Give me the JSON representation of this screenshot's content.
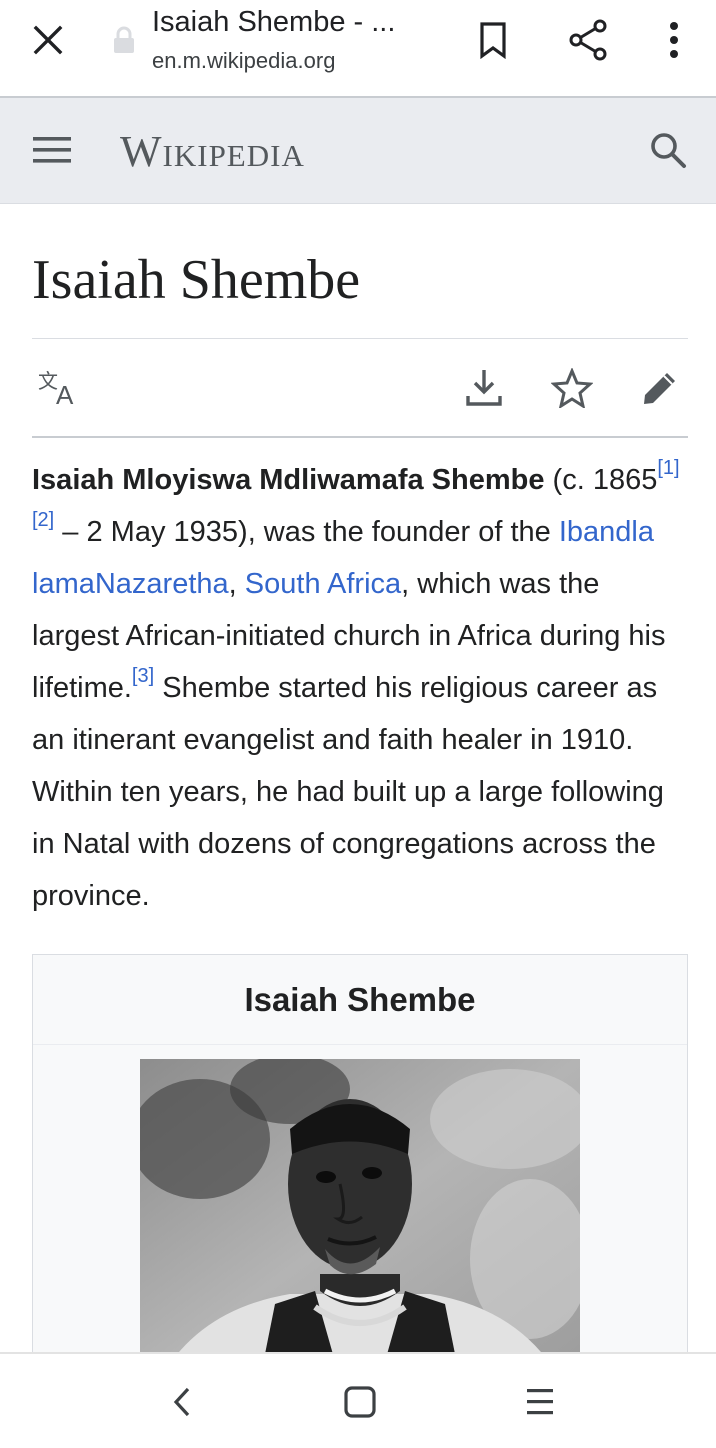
{
  "browser": {
    "tab_title": "Isaiah Shembe - ...",
    "url": "en.m.wikipedia.org",
    "icons": [
      "close-icon",
      "lock-icon",
      "bookmark-icon",
      "share-icon",
      "more-vert-icon"
    ]
  },
  "header": {
    "wordmark": "Wikipedia",
    "icons": [
      "menu-icon",
      "search-icon"
    ]
  },
  "article": {
    "title": "Isaiah Shembe",
    "actions": [
      "language-icon",
      "download-icon",
      "watch-star-icon",
      "edit-pencil-icon"
    ],
    "lead": {
      "name": "Isaiah Mloyiswa Mdliwamafa Shembe",
      "t1": " (c. 1865",
      "ref1": "[1]",
      "ref2": "[2]",
      "t2": " – 2 May 1935), was the founder of the ",
      "link1": "Ibandla lamaNazaretha",
      "t3": ", ",
      "link2": "South Africa",
      "t4": ", which was the largest African-initiated church in Africa during his lifetime.",
      "ref3": "[3]",
      "t5": " Shembe started his religious career as an itinerant evangelist and faith healer in 1910. Within ten years, he had built up a large following in Natal with dozens of congregations across the province."
    },
    "infobox": {
      "title": "Isaiah Shembe",
      "image": "portrait-photo"
    }
  },
  "android_nav": {
    "icons": [
      "back-icon",
      "home-icon",
      "recents-icon"
    ]
  },
  "colors": {
    "link": "#3366cc",
    "header_bg": "#eaecf0",
    "text": "#202122"
  }
}
